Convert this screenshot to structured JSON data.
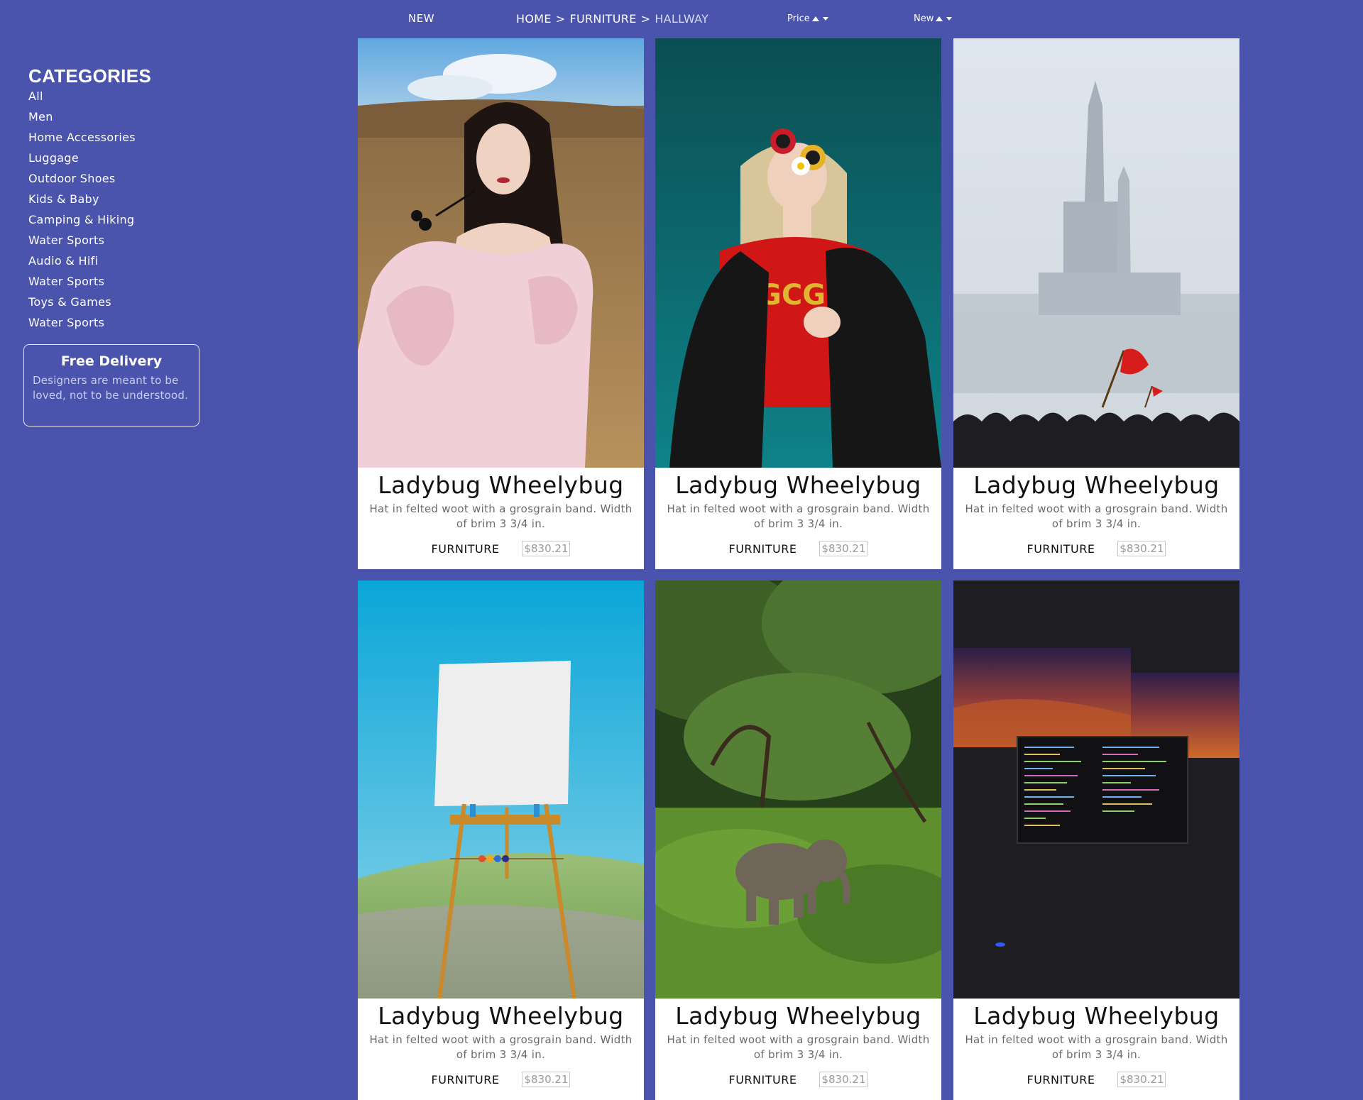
{
  "header": {
    "new_label": "NEW",
    "breadcrumb": [
      "HOME",
      "FURNITURE",
      "HALLWAY"
    ],
    "breadcrumb_sep": ">",
    "sort_price": "Price",
    "sort_new": "New"
  },
  "sidebar": {
    "title": "CATEGORIES",
    "items": [
      "All",
      "Men",
      "Home Accessories",
      "Luggage",
      "Outdoor Shoes",
      "Kids & Baby",
      "Camping & Hiking",
      "Water Sports",
      "Audio & Hifi",
      "Water Sports",
      "Toys & Games",
      "Water Sports"
    ],
    "promo": {
      "title": "Free Delivery",
      "text": "Designers are meant to be loved, not to be understood."
    }
  },
  "products": [
    {
      "title": "Ladybug Wheelybug",
      "desc": "Hat in felted woot with a grosgrain band. Width of brim 3 3/4 in.",
      "category": "FURNITURE",
      "price": "$830.21"
    },
    {
      "title": "Ladybug Wheelybug",
      "desc": "Hat in felted woot with a grosgrain band. Width of brim 3 3/4 in.",
      "category": "FURNITURE",
      "price": "$830.21"
    },
    {
      "title": "Ladybug Wheelybug",
      "desc": "Hat in felted woot with a grosgrain band. Width of brim 3 3/4 in.",
      "category": "FURNITURE",
      "price": "$830.21"
    },
    {
      "title": "Ladybug Wheelybug",
      "desc": "Hat in felted woot with a grosgrain band. Width of brim 3 3/4 in.",
      "category": "FURNITURE",
      "price": "$830.21"
    },
    {
      "title": "Ladybug Wheelybug",
      "desc": "Hat in felted woot with a grosgrain band. Width of brim 3 3/4 in.",
      "category": "FURNITURE",
      "price": "$830.21"
    },
    {
      "title": "Ladybug Wheelybug",
      "desc": "Hat in felted woot with a grosgrain band. Width of brim 3 3/4 in.",
      "category": "FURNITURE",
      "price": "$830.21"
    }
  ],
  "colors": {
    "page_bg": "#4a54ad",
    "card_bg": "#ffffff"
  }
}
